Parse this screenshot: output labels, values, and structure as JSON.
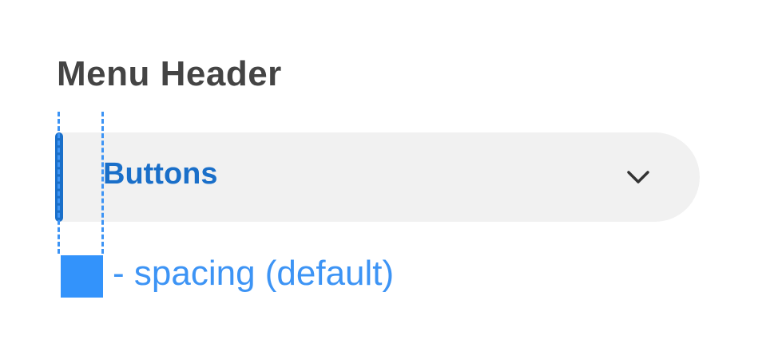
{
  "menu": {
    "header": "Menu Header",
    "item_label": "Buttons",
    "item_icon": "chevron-down-icon",
    "accent_color": "#1a6fc9"
  },
  "legend": {
    "swatch_color": "#3393fb",
    "text": "- spacing (default)"
  }
}
